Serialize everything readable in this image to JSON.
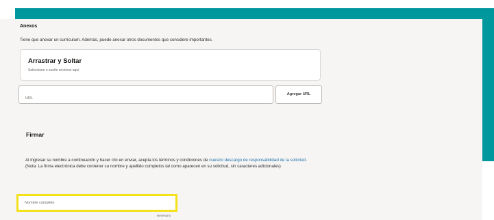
{
  "colors": {
    "accent_frame": "#00979d",
    "highlight_border": "#f3e11a",
    "link": "#1f6fa8",
    "card_background": "#f6f5f4"
  },
  "attachments": {
    "title": "Anexos",
    "description": "Tiene que anexar un currículum. Además, puede anexar otros documentos que considere importantes.",
    "dropzone": {
      "title": "Arrastrar y Soltar",
      "hint": "Seleccione o suelte archivos aquí."
    },
    "url_field": {
      "placeholder": "URL",
      "value": ""
    },
    "add_url_button": "Agregar URL"
  },
  "signature": {
    "title": "Firmar",
    "text_before_link": "Al ingresar su nombre a continuación y hacer clic en enviar, acepta los términos y condiciones de ",
    "link_text": "nuestro descargo de responsabilidad de la solicitud",
    "text_after_link": ". (Nota: La firma electrónica debe contener su nombre y apellido completos tal como aparecen en su solicitud, sin caracteres adicionales)",
    "full_name_field": {
      "placeholder": "Nombre completo",
      "value": ""
    },
    "required_note": "Necesario"
  }
}
